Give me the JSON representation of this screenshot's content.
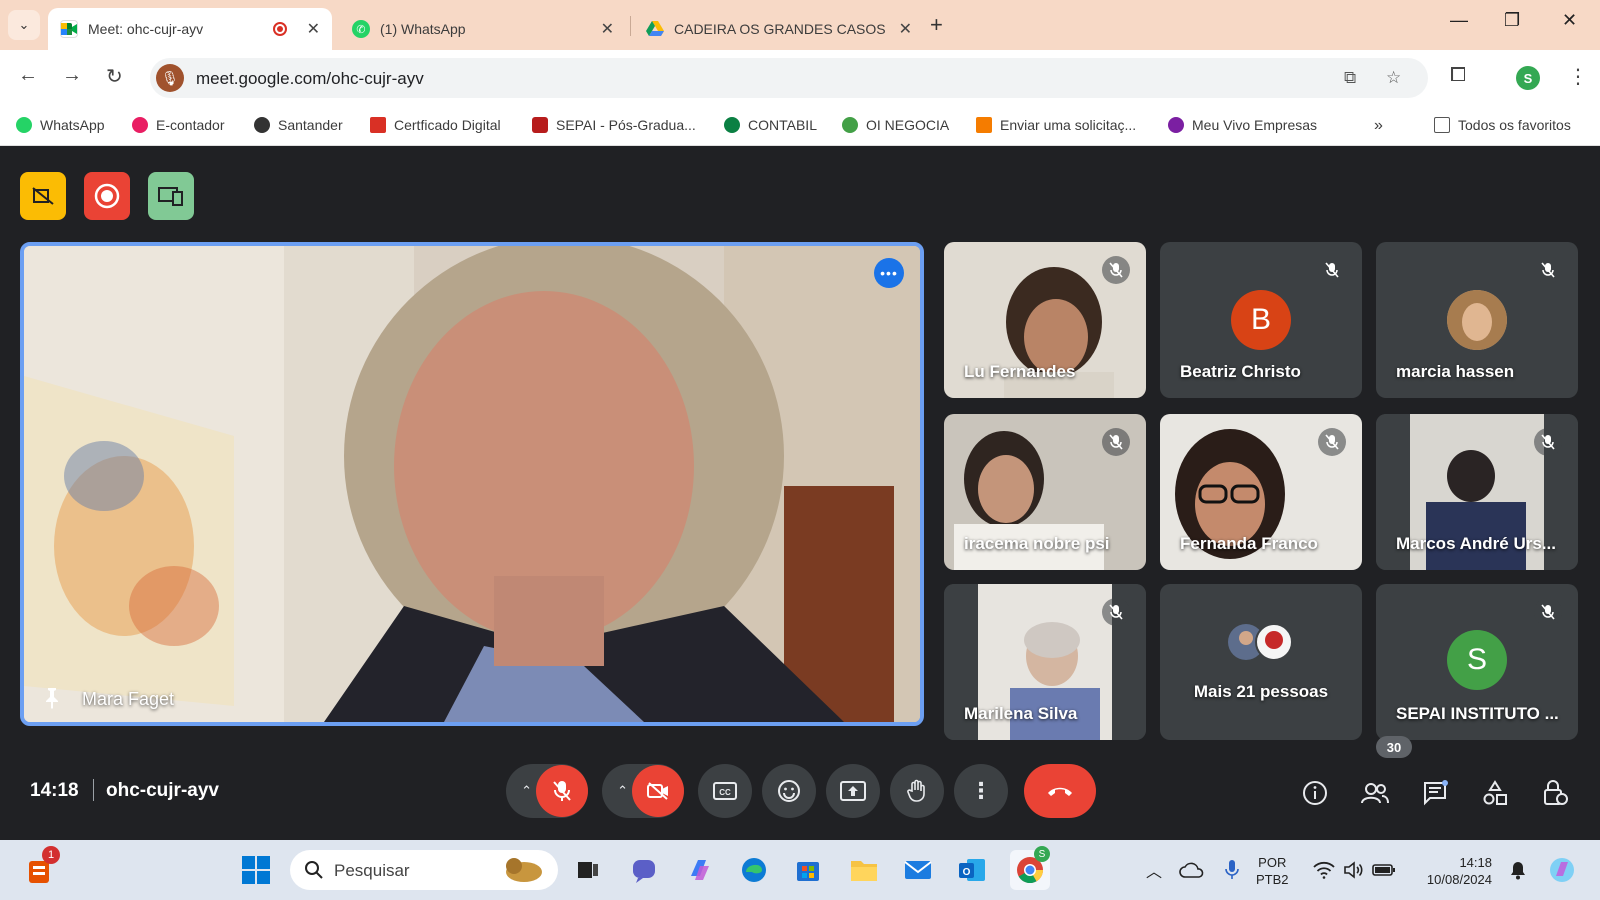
{
  "browser": {
    "tabs": [
      {
        "title": "Meet: ohc-cujr-ayv",
        "active": true
      },
      {
        "title": "(1) WhatsApp",
        "active": false
      },
      {
        "title": "CADEIRA OS GRANDES CASOS",
        "active": false
      }
    ],
    "new_tab_label": "+",
    "url": "meet.google.com/ohc-cujr-ayv",
    "profile_initial": "S",
    "bookmarks": [
      {
        "label": "WhatsApp",
        "color": "#25d366"
      },
      {
        "label": "E-contador",
        "color": "#e91e63"
      },
      {
        "label": "Santander",
        "color": "#333333"
      },
      {
        "label": "Certficado Digital",
        "color": "#d93025"
      },
      {
        "label": "SEPAI - Pós-Gradua...",
        "color": "#b71c1c"
      },
      {
        "label": "CONTABIL",
        "color": "#0b8043"
      },
      {
        "label": "OI NEGOCIA",
        "color": "#43a047"
      },
      {
        "label": "Enviar uma solicitaç...",
        "color": "#f57c00"
      },
      {
        "label": "Meu Vivo Empresas",
        "color": "#7b1fa2"
      }
    ],
    "bookmarks_overflow": "»",
    "all_bookmarks": "Todos os favoritos"
  },
  "meet": {
    "time": "14:18",
    "meeting_code": "ohc-cujr-ayv",
    "main_speaker": "Mara Faget",
    "participants": [
      {
        "name": "Lu Fernandes",
        "type": "video",
        "muted": true
      },
      {
        "name": "Beatriz Christo",
        "type": "avatar",
        "initial": "B",
        "color": "#d84315",
        "muted": true
      },
      {
        "name": "marcia hassen",
        "type": "photo",
        "muted": true
      },
      {
        "name": "iracema nobre psi",
        "type": "video",
        "muted": true
      },
      {
        "name": "Fernanda Franco",
        "type": "video",
        "muted": true
      },
      {
        "name": "Marcos André Urs...",
        "type": "video",
        "muted": true
      },
      {
        "name": "Marilena Silva",
        "type": "video",
        "muted": true
      },
      {
        "name": "Mais 21 pessoas",
        "type": "more",
        "muted": false
      },
      {
        "name": "SEPAI INSTITUTO ...",
        "type": "avatar",
        "initial": "S",
        "color": "#43a047",
        "muted": true
      }
    ],
    "people_count": "30",
    "colors": {
      "accent": "#1a73e8",
      "danger": "#ea4335",
      "tile": "#3c4043",
      "bg": "#202124"
    }
  },
  "taskbar": {
    "search_placeholder": "Pesquisar",
    "notification_count": "1",
    "chrome_badge": "S",
    "language": "POR",
    "keyboard": "PTB2",
    "clock_time": "14:18",
    "clock_date": "10/08/2024"
  }
}
